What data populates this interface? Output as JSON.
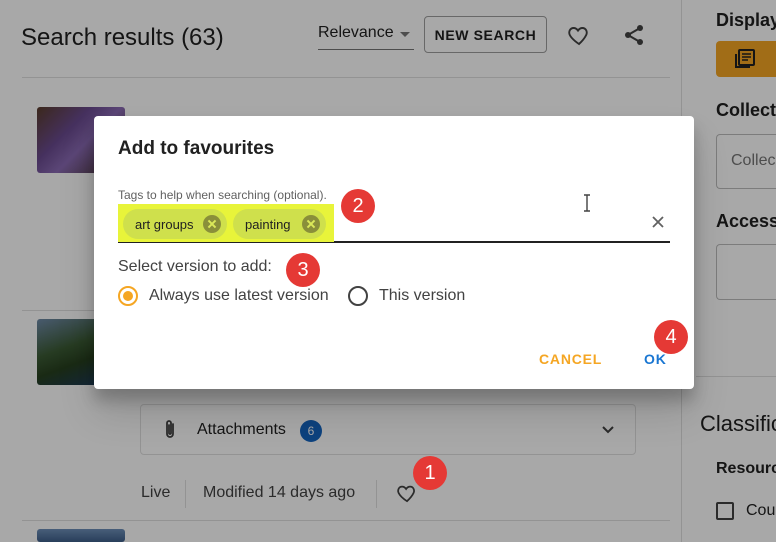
{
  "header": {
    "title": "Search results (63)",
    "sort_value": "Relevance",
    "new_search_label": "NEW SEARCH",
    "icons": [
      "heart-outline-icon",
      "share-icon"
    ]
  },
  "result_item": {
    "attachments_label": "Attachments",
    "attachments_count": "6",
    "status": "Live",
    "modified": "Modified 14 days ago"
  },
  "right_panel": {
    "display_label": "Display",
    "collections_label": "Collect",
    "collections_placeholder": "Collec",
    "access_label": "Access",
    "classification_label": "Classific",
    "resource_label": "Resourc",
    "checkbox_label": "Cou"
  },
  "dialog": {
    "title": "Add to favourites",
    "tags_label": "Tags to help when searching (optional).",
    "tags": [
      "art groups",
      "painting"
    ],
    "version_label": "Select version to add:",
    "version_options": [
      "Always use latest version",
      "This version"
    ],
    "selected_version": "Always use latest version",
    "cancel_label": "CANCEL",
    "ok_label": "OK"
  },
  "step_badges": [
    "1",
    "2",
    "3",
    "4"
  ],
  "colors": {
    "accent": "#f5a623",
    "primary": "#1976d2",
    "badge": "#e53935",
    "highlight": "#e8f43a",
    "count_badge": "#1565c0"
  }
}
